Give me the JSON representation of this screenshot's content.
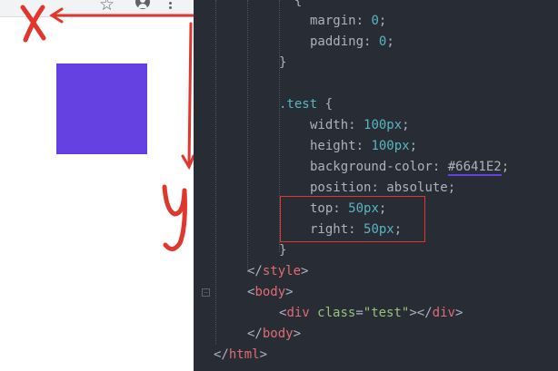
{
  "browser": {
    "icons": [
      "star-icon",
      "profile-icon",
      "menu-icon"
    ],
    "box": {
      "color": "#6641E2"
    },
    "annotations": {
      "x_label": "X",
      "y_label": "Y",
      "arrow_color": "#e0362d"
    }
  },
  "editor": {
    "lines": [
      {
        "text": "  {"
      },
      {
        "prop": "margin",
        "value": "0"
      },
      {
        "prop": "padding",
        "value": "0"
      },
      {
        "text": "}"
      },
      {
        "text": ""
      },
      {
        "selector": ".test",
        "brace": " {"
      },
      {
        "prop": "width",
        "value": "100px"
      },
      {
        "prop": "height",
        "value": "100px"
      },
      {
        "prop": "background-color",
        "value": "#6641E2"
      },
      {
        "prop": "position",
        "value": "absolute"
      },
      {
        "prop": "top",
        "value": "50px"
      },
      {
        "prop": "right",
        "value": "50px"
      },
      {
        "text": "}"
      },
      {
        "close_tag": "style"
      },
      {
        "open_tag": "body"
      },
      {
        "div_tag": "div",
        "attr": "class",
        "attr_value": "\"test\""
      },
      {
        "close_tag": "body"
      },
      {
        "close_tag": "html"
      }
    ]
  }
}
